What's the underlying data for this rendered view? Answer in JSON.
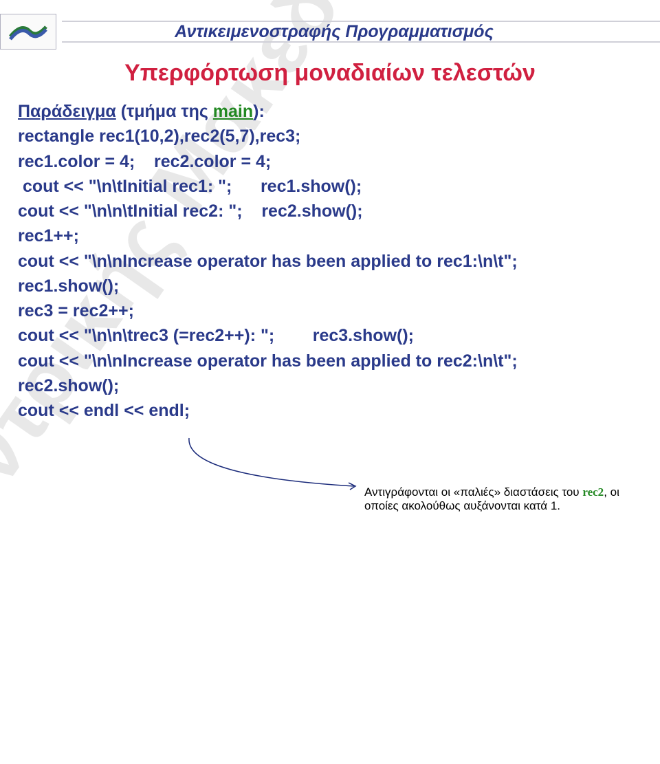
{
  "header": {
    "title": "Αντικειμενοστραφής Προγραμματισμός"
  },
  "section_title": "Υπερφόρτωση μοναδιαίων τελεστών",
  "code": {
    "line1_a": "Παράδειγμα",
    "line1_b": " (τμήμα της ",
    "line1_c": "main",
    "line1_d": "):",
    "line2": "rectangle rec1(10,2),rec2(5,7),rec3;",
    "line3": "rec1.color = 4;    rec2.color = 4;",
    "line4": " cout << \"\\n\\tInitial rec1: \";      rec1.show();",
    "line5": "cout << \"\\n\\n\\tInitial rec2: \";    rec2.show();",
    "line6": "rec1++;",
    "line7": "cout << \"\\n\\nIncrease operator has been applied to rec1:\\n\\t\";",
    "line8": "rec1.show();",
    "line9": "rec3 = rec2++;",
    "line10": "cout << \"\\n\\n\\trec3 (=rec2++): \";        rec3.show();",
    "line11": "cout << \"\\n\\nIncrease operator has been applied to rec2:\\n\\t\";",
    "line12": "rec2.show();",
    "line13": "cout << endl << endl;"
  },
  "note": {
    "part1": "Αντιγράφονται οι «παλιές» διαστάσεις του ",
    "id": "rec2",
    "part2": ", οι οποίες ακολούθως αυξάνονται κατά 1."
  },
  "watermark": "Τ.Ε.Ι. Κεντρικής Μακεδονίας"
}
